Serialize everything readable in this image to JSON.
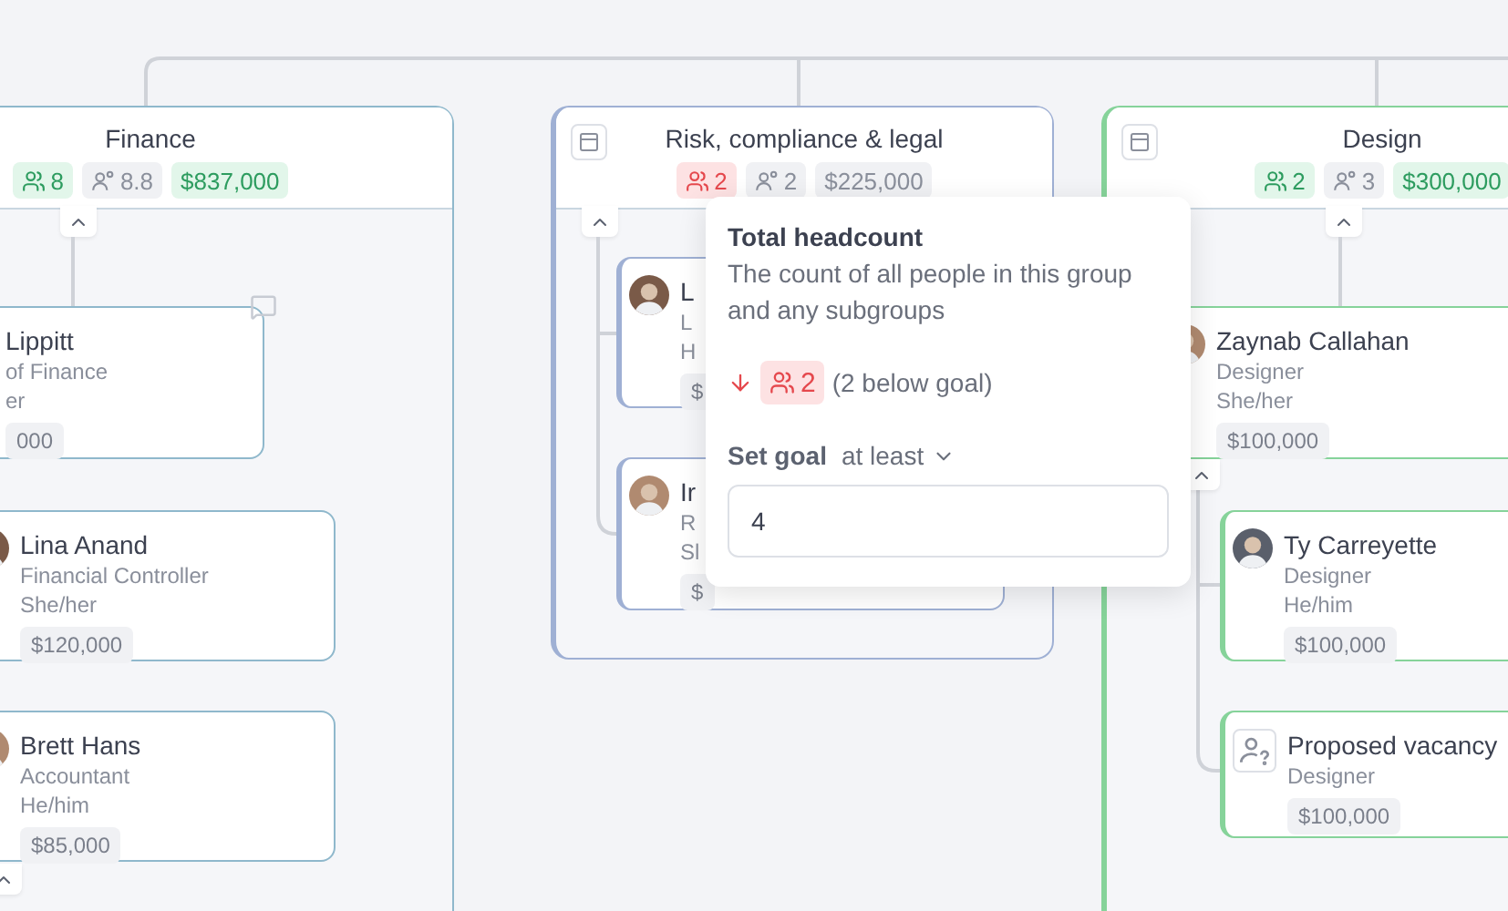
{
  "groups": [
    {
      "title": "Finance",
      "color": "#8fb8cc",
      "icon": false,
      "expanded": true,
      "badges": [
        {
          "kind": "headcount",
          "value": "8",
          "color": "#e2f6ea"
        },
        {
          "kind": "ratio",
          "value": "8.8",
          "color": "#f0f1f4"
        },
        {
          "kind": "budget",
          "value": "$837,000",
          "color": "#e2f6ea"
        }
      ],
      "cards": [
        {
          "name": "Lippitt",
          "title": "of Finance",
          "pronouns": "er",
          "salary": "000",
          "kind": "person",
          "comment": true
        },
        {
          "name": "Lina Anand",
          "title": "Financial Controller",
          "pronouns": "She/her",
          "salary": "$120,000",
          "kind": "person"
        },
        {
          "name": "Brett Hans",
          "title": "Accountant",
          "pronouns": "He/him",
          "salary": "$85,000",
          "kind": "person",
          "expanded": true
        }
      ]
    },
    {
      "title": "Risk, compliance & legal",
      "color": "#9fb0d4",
      "icon": true,
      "expanded": true,
      "badges": [
        {
          "kind": "headcount",
          "value": "2",
          "color": "#fde2e3"
        },
        {
          "kind": "ratio",
          "value": "2",
          "color": "#f0f1f4"
        },
        {
          "kind": "budget",
          "value": "$225,000",
          "color": "#f0f1f4"
        }
      ],
      "cards": [
        {
          "name": "L",
          "title": "L",
          "pronouns": "H",
          "salary": "$",
          "kind": "person"
        },
        {
          "name": "Ir",
          "title": "R",
          "pronouns": "Sl",
          "salary": "$",
          "kind": "person"
        }
      ]
    },
    {
      "title": "Design",
      "color": "#86d39a",
      "icon": true,
      "expanded": true,
      "badges": [
        {
          "kind": "headcount",
          "value": "2",
          "color": "#e2f6ea"
        },
        {
          "kind": "ratio",
          "value": "3",
          "color": "#f0f1f4"
        },
        {
          "kind": "budget",
          "value": "$300,000",
          "color": "#e2f6ea"
        }
      ],
      "cards": [
        {
          "name": "Zaynab Callahan",
          "title": "Designer",
          "pronouns": "She/her",
          "salary": "$100,000",
          "kind": "person",
          "expanded": true
        },
        {
          "name": "Ty Carreyette",
          "title": "Designer",
          "pronouns": "He/him",
          "salary": "$100,000",
          "kind": "person"
        },
        {
          "name": "Proposed vacancy",
          "title": "Designer",
          "salary": "$100,000",
          "kind": "vacancy"
        }
      ]
    }
  ],
  "popover": {
    "title": "Total headcount",
    "description": "The count of all people in this group and any subgroups",
    "below_goal": true,
    "headcount": "2",
    "note": "(2 below goal)",
    "goal_label": "Set goal",
    "goal_mode": "at least",
    "goal_value": "4"
  }
}
